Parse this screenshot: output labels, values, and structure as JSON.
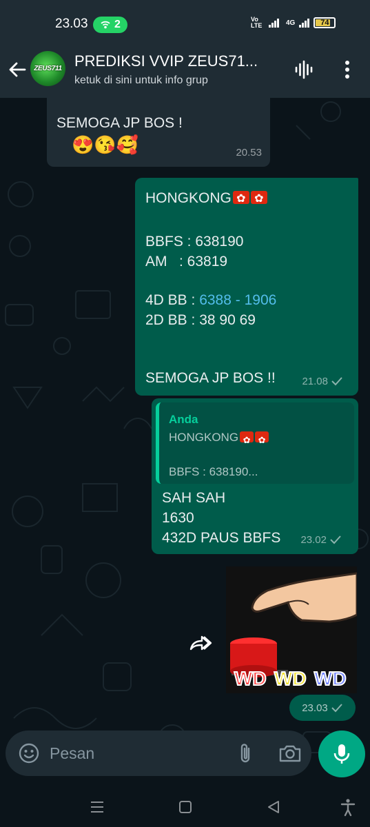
{
  "status_bar": {
    "time": "23.03",
    "hotspot_count": "2",
    "network_label": "4G",
    "volte_label": "Vo LTE",
    "battery_level": "74"
  },
  "header": {
    "title": "PREDIKSI VVIP ZEUS71...",
    "subtitle": "ketuk di sini untuk info grup",
    "avatar_text": "ZEUS711"
  },
  "messages": [
    {
      "type": "incoming",
      "text": "SEMOGA JP BOS !",
      "emojis": "😍😘🥰",
      "time": "20.53"
    },
    {
      "type": "outgoing",
      "lines": {
        "title": "HONGKONG",
        "bbfs": "BBFS : 638190",
        "am": "AM   : 63819",
        "bb4_label": "4D BB : ",
        "bb4_link": "6388 - 1906",
        "bb2": "2D BB : 38 90 69",
        "closing": "SEMOGA JP BOS !!"
      },
      "time": "21.08"
    },
    {
      "type": "outgoing-reply",
      "quote": {
        "sender": "Anda",
        "line1": "HONGKONG",
        "line2": "BBFS : 638190..."
      },
      "lines": {
        "l1": "SAH SAH",
        "l2": "1630",
        "l3": "432D PAUS BBFS"
      },
      "time": "23.02"
    },
    {
      "type": "outgoing-sticker",
      "sticker_text": [
        "WD",
        "WD",
        "WD"
      ],
      "time": "23.03"
    }
  ],
  "composer": {
    "placeholder": "Pesan"
  },
  "icons": {
    "back": "arrow-left-icon",
    "audio_call": "audio-wave-icon",
    "menu": "kebab-menu-icon",
    "emoji": "emoji-icon",
    "attach": "paperclip-icon",
    "camera": "camera-icon",
    "mic": "microphone-icon",
    "forward": "forward-icon"
  },
  "colors": {
    "background": "#0b141a",
    "header": "#1f2c34",
    "incoming_bubble": "#1f2c34",
    "outgoing_bubble": "#005c4b",
    "accent": "#00a884",
    "link": "#53bdeb",
    "quote_accent": "#06cf9c"
  }
}
